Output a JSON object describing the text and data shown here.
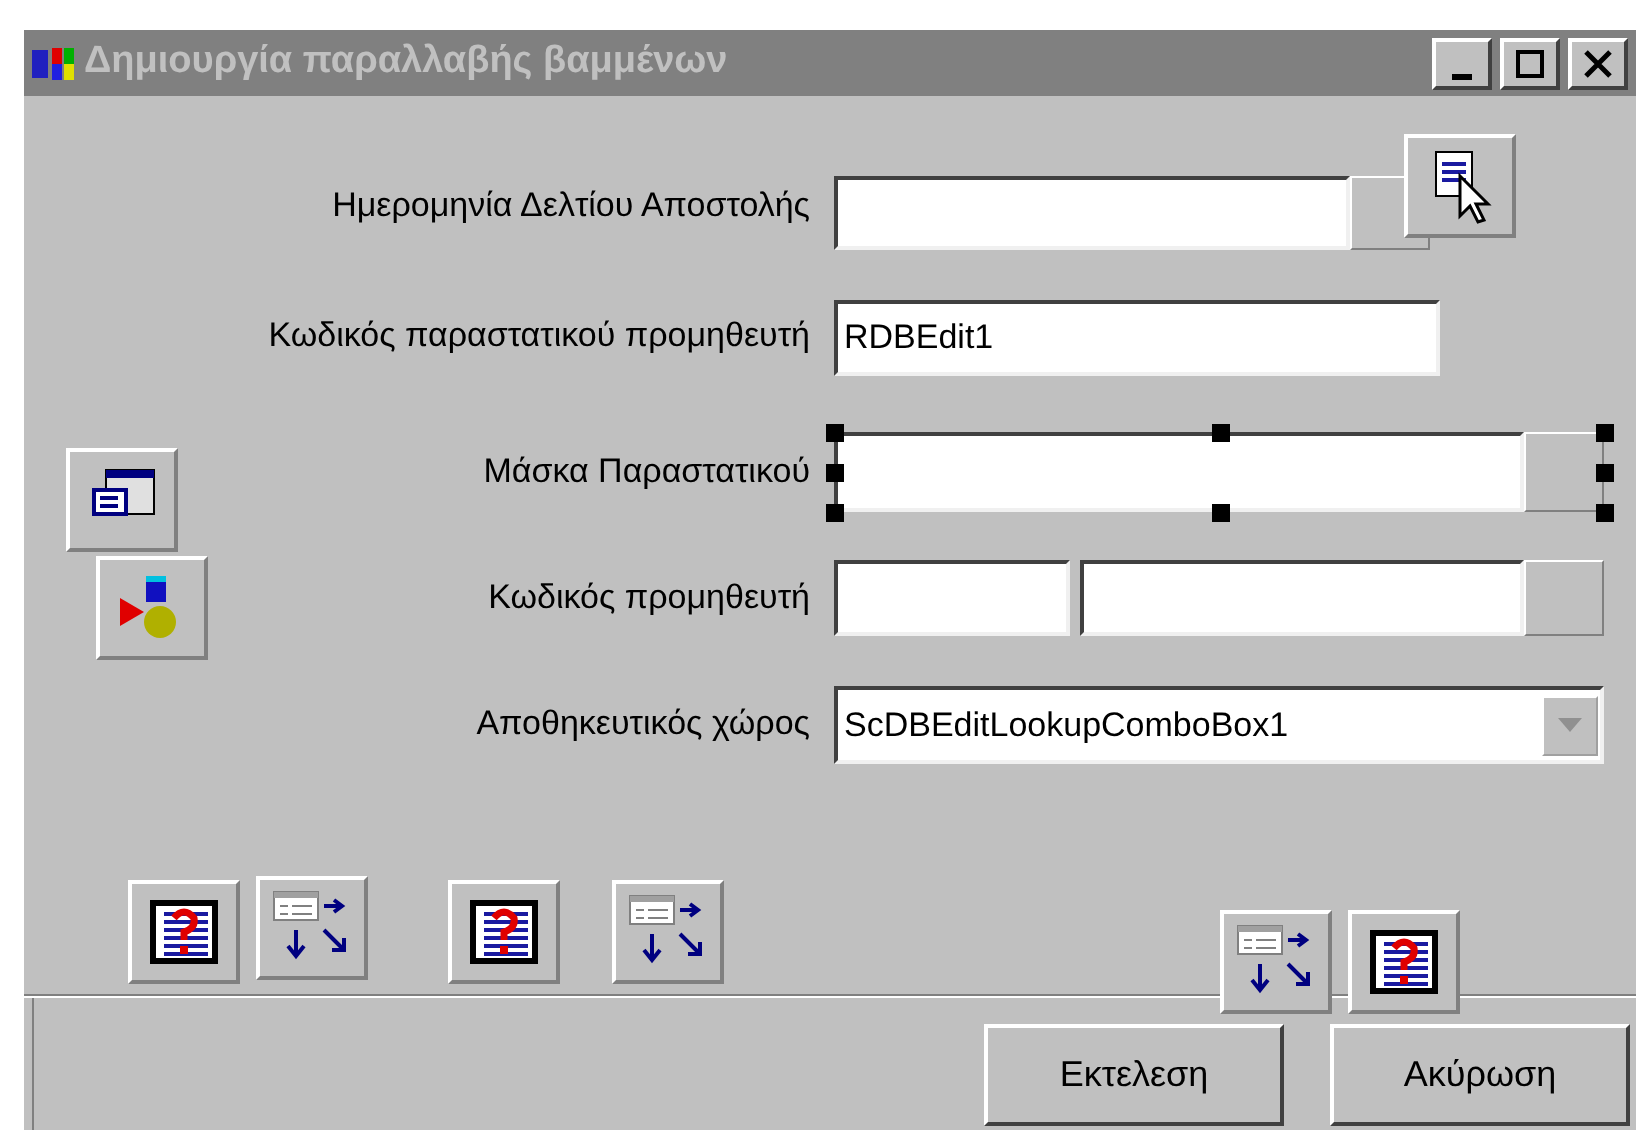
{
  "window": {
    "title": "Δημιουργία παραλλαβής βαμμένων"
  },
  "fields": [
    {
      "kind": "lookup",
      "label": "Ημερομηνία Δελτίου Αποστολής",
      "selected": false
    },
    {
      "kind": "edit",
      "label": "Κωδικός παραστατικού προμηθευτή",
      "value": "RDBEdit1",
      "selected": false
    },
    {
      "kind": "lookup",
      "label": "Μάσκα Παραστατικού",
      "selected": true
    },
    {
      "kind": "pair",
      "label": "Κωδικός προμηθευτή",
      "selected": false
    },
    {
      "kind": "combo",
      "label": "Αποθηκευτικός χώρος",
      "value": "ScDBEditLookupComboBox1",
      "selected": false
    }
  ],
  "components": [
    {
      "kind": "pointer"
    },
    {
      "kind": "window"
    },
    {
      "kind": "shapes"
    },
    {
      "kind": "help"
    },
    {
      "kind": "flow"
    },
    {
      "kind": "help"
    },
    {
      "kind": "flow"
    },
    {
      "kind": "flow"
    },
    {
      "kind": "help"
    }
  ],
  "buttons": [
    {
      "label": "Εκτελεση"
    },
    {
      "label": "Ακύρωση"
    }
  ]
}
